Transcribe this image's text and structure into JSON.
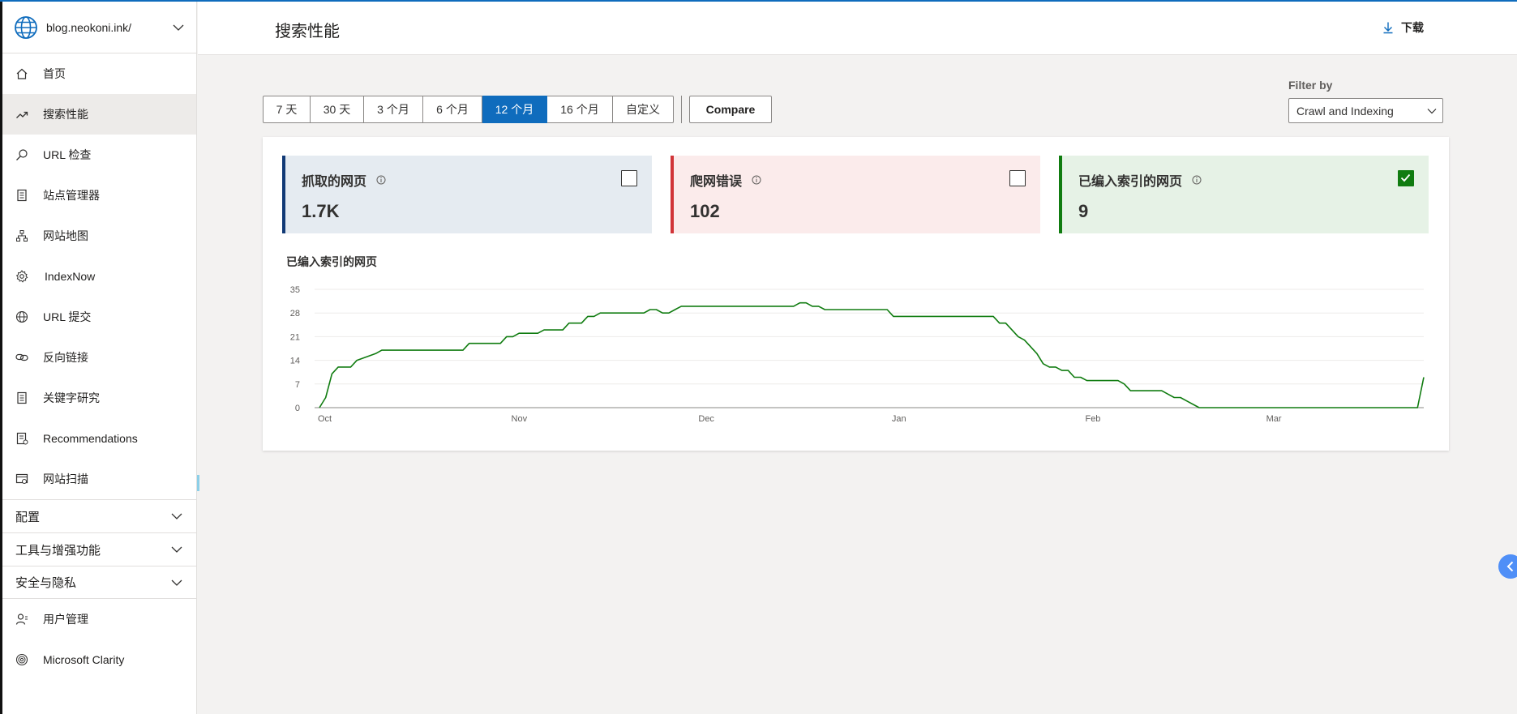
{
  "site": {
    "name": "blog.neokoni.ink/"
  },
  "nav": {
    "items": [
      {
        "label": "首页",
        "icon": "home-icon"
      },
      {
        "label": "搜索性能",
        "icon": "trend-icon",
        "active": true
      },
      {
        "label": "URL 检查",
        "icon": "search-icon"
      },
      {
        "label": "站点管理器",
        "icon": "document-icon"
      },
      {
        "label": "网站地图",
        "icon": "sitemap-icon"
      },
      {
        "label": "IndexNow",
        "icon": "gear-icon"
      },
      {
        "label": "URL 提交",
        "icon": "globe-icon"
      },
      {
        "label": "反向链接",
        "icon": "link-icon"
      },
      {
        "label": "关键字研究",
        "icon": "document-icon"
      },
      {
        "label": "Recommendations",
        "icon": "checklist-icon"
      },
      {
        "label": "网站扫描",
        "icon": "scan-icon"
      }
    ],
    "groups": [
      {
        "label": "配置"
      },
      {
        "label": "工具与增强功能"
      },
      {
        "label": "安全与隐私"
      }
    ],
    "bottom_items": [
      {
        "label": "用户管理",
        "icon": "user-icon"
      },
      {
        "label": "Microsoft Clarity",
        "icon": "clarity-icon"
      }
    ]
  },
  "header": {
    "title": "搜索性能",
    "download": "下载"
  },
  "ranges": {
    "items": [
      "7 天",
      "30 天",
      "3 个月",
      "6 个月",
      "12 个月",
      "16 个月",
      "自定义"
    ],
    "selected": "12 个月"
  },
  "compare": "Compare",
  "filter": {
    "label": "Filter by",
    "value": "Crawl and Indexing"
  },
  "cards": [
    {
      "title": "抓取的网页",
      "value": "1.7K",
      "checked": false,
      "accent": "#123a76"
    },
    {
      "title": "爬网错误",
      "value": "102",
      "checked": false,
      "accent": "#d13438"
    },
    {
      "title": "已编入索引的网页",
      "value": "9",
      "checked": true,
      "accent": "#107c10"
    }
  ],
  "chart_data": {
    "type": "line",
    "title": "已编入索引的网页",
    "xlabel": "",
    "ylabel": "",
    "y_ticks": [
      0,
      7,
      14,
      21,
      28,
      35
    ],
    "ylim": [
      0,
      35
    ],
    "x_ticks": [
      "Oct",
      "Nov",
      "Dec",
      "Jan",
      "Feb",
      "Mar"
    ],
    "x_range": [
      "2023-10-01",
      "2024-03-26"
    ],
    "grid": true,
    "color": "#107c10",
    "points": [
      [
        "2023-10-01",
        0
      ],
      [
        "2023-10-02",
        3
      ],
      [
        "2023-10-03",
        10
      ],
      [
        "2023-10-04",
        12
      ],
      [
        "2023-10-06",
        12
      ],
      [
        "2023-10-07",
        14
      ],
      [
        "2023-10-10",
        16
      ],
      [
        "2023-10-11",
        17
      ],
      [
        "2023-10-24",
        17
      ],
      [
        "2023-10-25",
        19
      ],
      [
        "2023-10-30",
        19
      ],
      [
        "2023-10-31",
        21
      ],
      [
        "2023-11-01",
        21
      ],
      [
        "2023-11-02",
        22
      ],
      [
        "2023-11-05",
        22
      ],
      [
        "2023-11-06",
        23
      ],
      [
        "2023-11-09",
        23
      ],
      [
        "2023-11-10",
        25
      ],
      [
        "2023-11-12",
        25
      ],
      [
        "2023-11-13",
        27
      ],
      [
        "2023-11-14",
        27
      ],
      [
        "2023-11-15",
        28
      ],
      [
        "2023-11-22",
        28
      ],
      [
        "2023-11-23",
        29
      ],
      [
        "2023-11-24",
        29
      ],
      [
        "2023-11-25",
        28
      ],
      [
        "2023-11-26",
        28
      ],
      [
        "2023-11-27",
        29
      ],
      [
        "2023-11-28",
        30
      ],
      [
        "2023-12-16",
        30
      ],
      [
        "2023-12-17",
        31
      ],
      [
        "2023-12-18",
        31
      ],
      [
        "2023-12-19",
        30
      ],
      [
        "2023-12-20",
        30
      ],
      [
        "2023-12-21",
        29
      ],
      [
        "2023-12-31",
        29
      ],
      [
        "2024-01-01",
        27
      ],
      [
        "2024-01-17",
        27
      ],
      [
        "2024-01-18",
        25
      ],
      [
        "2024-01-19",
        25
      ],
      [
        "2024-01-20",
        23
      ],
      [
        "2024-01-21",
        21
      ],
      [
        "2024-01-22",
        20
      ],
      [
        "2024-01-23",
        18
      ],
      [
        "2024-01-24",
        16
      ],
      [
        "2024-01-25",
        13
      ],
      [
        "2024-01-26",
        12
      ],
      [
        "2024-01-27",
        12
      ],
      [
        "2024-01-28",
        11
      ],
      [
        "2024-01-29",
        11
      ],
      [
        "2024-01-30",
        9
      ],
      [
        "2024-01-31",
        9
      ],
      [
        "2024-02-01",
        8
      ],
      [
        "2024-02-06",
        8
      ],
      [
        "2024-02-07",
        7
      ],
      [
        "2024-02-08",
        5
      ],
      [
        "2024-02-13",
        5
      ],
      [
        "2024-02-14",
        4
      ],
      [
        "2024-02-15",
        3
      ],
      [
        "2024-02-16",
        3
      ],
      [
        "2024-02-17",
        2
      ],
      [
        "2024-02-19",
        0
      ],
      [
        "2024-03-25",
        0
      ],
      [
        "2024-03-26",
        9
      ]
    ]
  }
}
